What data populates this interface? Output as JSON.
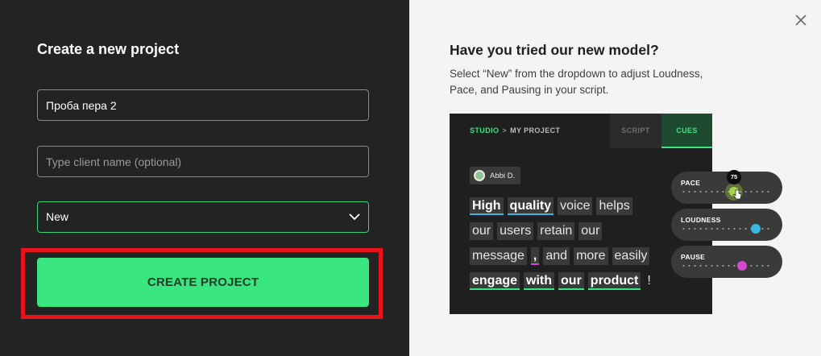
{
  "left": {
    "title": "Create a new project",
    "project_name_value": "Проба пера 2",
    "client_name_placeholder": "Type client name (optional)",
    "model_select_value": "New",
    "create_button_label": "CREATE PROJECT"
  },
  "right": {
    "title": "Have you tried our new model?",
    "description": "Select “New” from the dropdown to adjust Loudness, Pace, and Pausing in your script.",
    "preview": {
      "breadcrumb_studio": "STUDIO",
      "breadcrumb_separator": ">",
      "breadcrumb_project": "MY PROJECT",
      "tab_script": "SCRIPT",
      "tab_cues": "CUES",
      "speaker_name": "Abbi D.",
      "lines": [
        [
          "High",
          "quality",
          "voice",
          "helps"
        ],
        [
          "our",
          "users",
          "retain",
          "our"
        ],
        [
          "message",
          ",",
          "and",
          "more",
          "easily"
        ],
        [
          "engage",
          "with",
          "our",
          "product",
          "!"
        ]
      ],
      "sliders": {
        "pace_label": "PACE",
        "pace_value": "75",
        "loudness_label": "LOUDNESS",
        "pause_label": "PAUSE"
      }
    }
  },
  "colors": {
    "accent_green": "#38e57e",
    "highlight_red": "#e8141b",
    "underline_blue": "#3ab6e0",
    "underline_pink": "#d34ad0",
    "pace_knob": "#a5d645",
    "loudness_knob": "#3ab6e0",
    "pause_knob": "#d34ad0"
  }
}
